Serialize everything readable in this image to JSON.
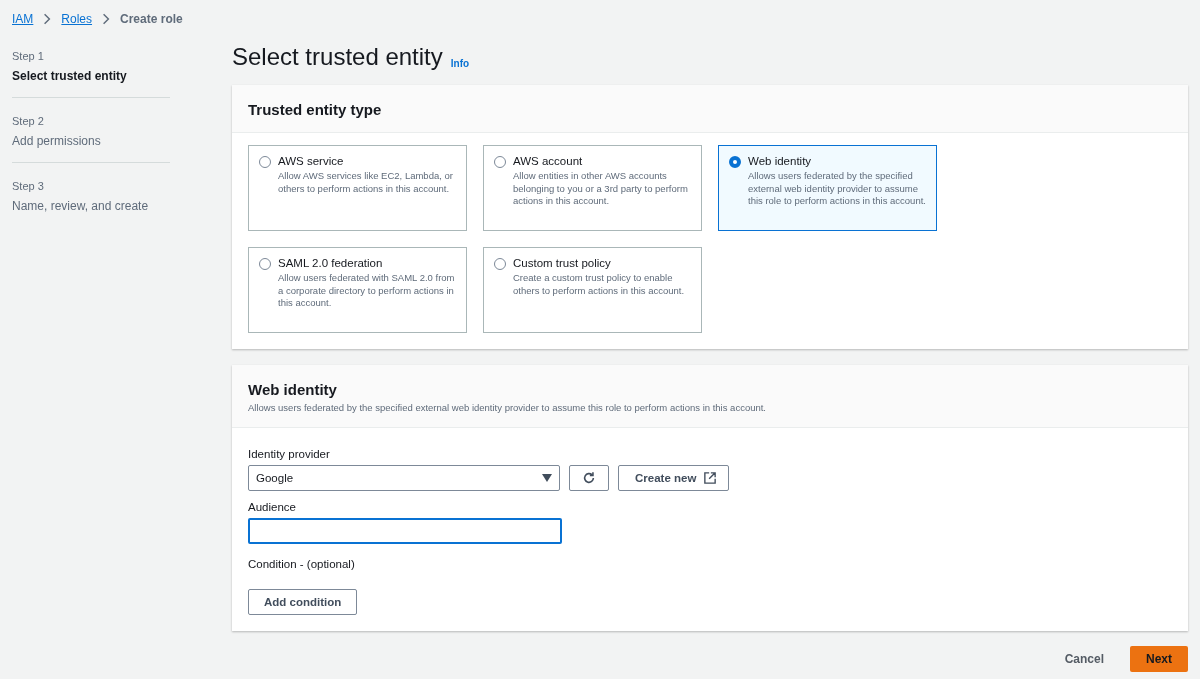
{
  "breadcrumb": [
    {
      "label": "IAM",
      "kind": "link"
    },
    {
      "label": "Roles",
      "kind": "link"
    },
    {
      "label": "Create role",
      "kind": "current"
    }
  ],
  "steps": [
    {
      "step": "Step 1",
      "label": "Select trusted entity",
      "selected": true
    },
    {
      "step": "Step 2",
      "label": "Add permissions",
      "selected": false
    },
    {
      "step": "Step 3",
      "label": "Name, review, and create",
      "selected": false
    }
  ],
  "page": {
    "title": "Select trusted entity",
    "info": "Info"
  },
  "entity_panel": {
    "title": "Trusted entity type",
    "options": [
      {
        "label": "AWS service",
        "description": "Allow AWS services like EC2, Lambda, or others to perform actions in this account.",
        "selected": false
      },
      {
        "label": "AWS account",
        "description": "Allow entities in other AWS accounts belonging to you or a 3rd party to perform actions in this account.",
        "selected": false
      },
      {
        "label": "Web identity",
        "description": "Allows users federated by the specified external web identity provider to assume this role to perform actions in this account.",
        "selected": true
      },
      {
        "label": "SAML 2.0 federation",
        "description": "Allow users federated with SAML 2.0 from a corporate directory to perform actions in this account.",
        "selected": false
      },
      {
        "label": "Custom trust policy",
        "description": "Create a custom trust policy to enable others to perform actions in this account.",
        "selected": false
      }
    ]
  },
  "web_identity": {
    "title": "Web identity",
    "description": "Allows users federated by the specified external web identity provider to assume this role to perform actions in this account.",
    "provider_label": "Identity provider",
    "provider_value": "Google",
    "create_new": "Create new",
    "audience_label": "Audience",
    "audience_focused": true,
    "condition_label": "Condition - (optional)",
    "add_condition": "Add condition"
  },
  "footer": {
    "cancel": "Cancel",
    "next": "Next"
  }
}
